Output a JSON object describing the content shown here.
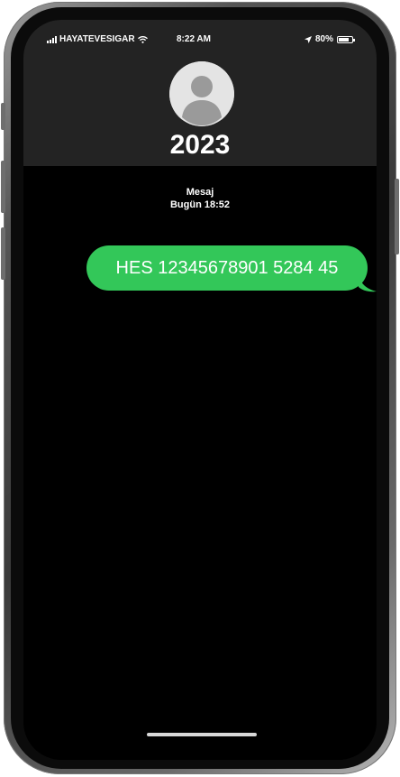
{
  "status_bar": {
    "carrier": "HAYATEVESIGAR",
    "time": "8:22 AM",
    "battery": "80%",
    "battery_level": 0.8
  },
  "contact": {
    "name": "2023"
  },
  "thread": {
    "service": "Mesaj",
    "timestamp": "Bugün 18:52"
  },
  "messages": [
    {
      "text": "HES 12345678901 5284 45",
      "direction": "outgoing"
    }
  ],
  "colors": {
    "bubble": "#33c759",
    "header_bg": "#232323",
    "screen_bg": "#000000"
  },
  "icons": [
    "signal-bars-icon",
    "wifi-icon",
    "location-arrow-icon",
    "battery-icon",
    "contact-avatar-icon"
  ]
}
